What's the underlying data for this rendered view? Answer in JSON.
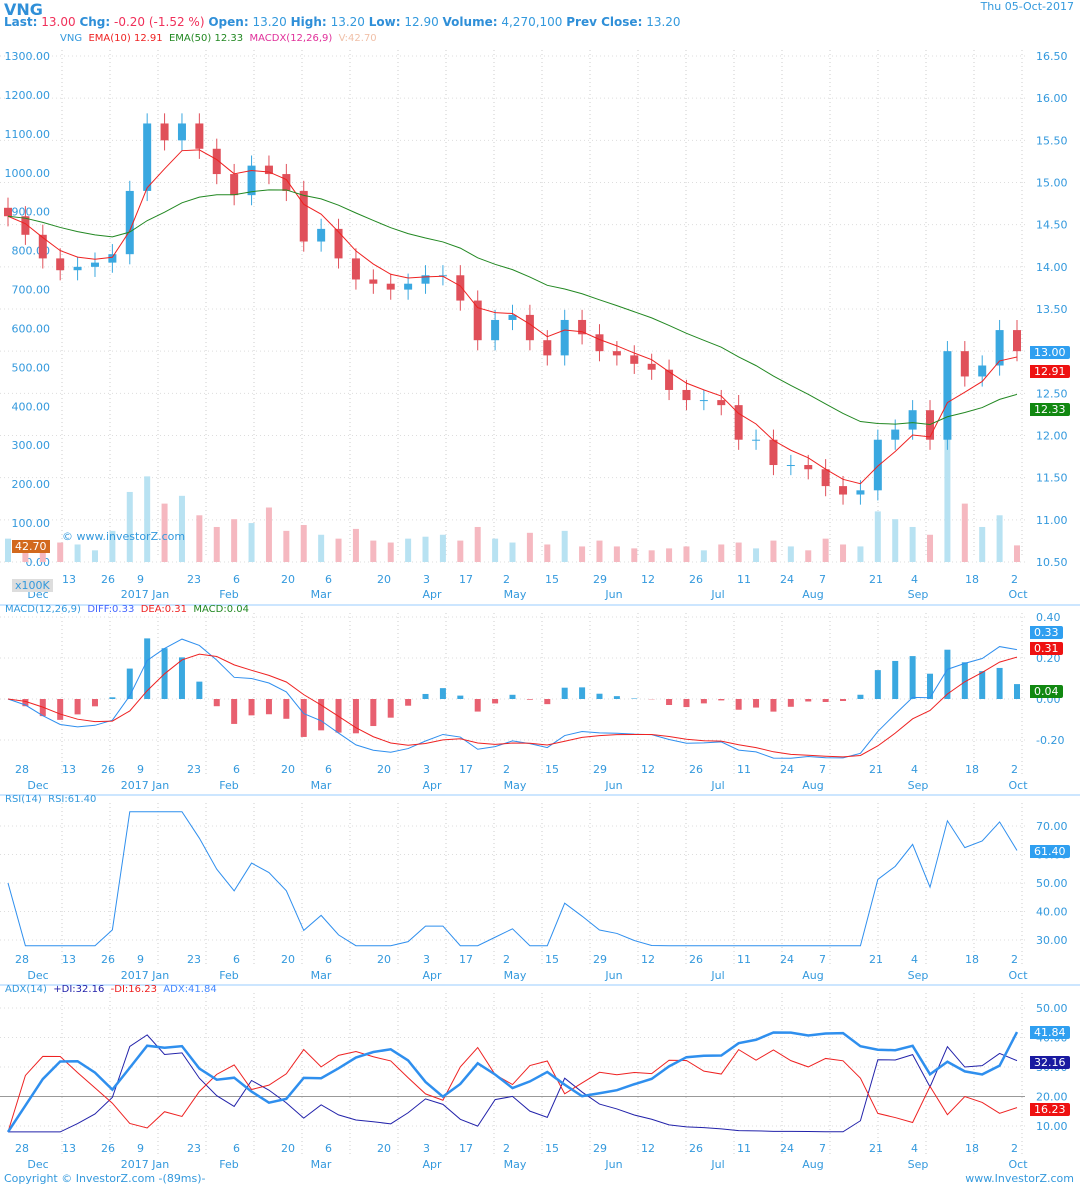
{
  "header": {
    "symbol": "VNG",
    "date": "Thu 05-Oct-2017",
    "last_label": "Last:",
    "last": "13.00",
    "chg_label": "Chg:",
    "chg": "-0.20 (-1.52 %)",
    "open_label": "Open:",
    "open": "13.20",
    "high_label": "High:",
    "high": "13.20",
    "low_label": "Low:",
    "low": "12.90",
    "volume_label": "Volume:",
    "volume": "4,270,100",
    "prev_label": "Prev Close:",
    "prev": "13.20"
  },
  "legend": {
    "sym": "VNG",
    "ema10": "EMA(10)",
    "ema10_val": "12.91",
    "ema50": "EMA(50)",
    "ema50_val": "12.33",
    "macdx": "MACDX(12,26,9)",
    "vol": "V:42.70"
  },
  "watermark": "© www.investorZ.com",
  "volume_badge": "42.70",
  "volume_unit": "x100K",
  "macd_legend": {
    "name": "MACD(12,26,9)",
    "diff": "DIFF:0.33",
    "dea": "DEA:0.31",
    "macd": "MACD:0.04"
  },
  "rsi_legend": {
    "name": "RSI(14)",
    "val": "RSI:61.40"
  },
  "adx_legend": {
    "name": "ADX(14)",
    "pdi": "+DI:32.16",
    "mdi": "-DI:16.23",
    "adx": "ADX:41.84"
  },
  "badges": {
    "close": "13.00",
    "ema10": "12.91",
    "ema50": "12.33",
    "diff": "0.33",
    "dea": "0.31",
    "macd": "0.04",
    "rsi": "61.40",
    "adx": "41.84",
    "pdi": "32.16",
    "mdi": "16.23"
  },
  "footer": {
    "left": "Copyright © InvestorZ.com -(89ms)-",
    "right": "www.InvestorZ.com"
  },
  "colors": {
    "up": "#3aa8e0",
    "down": "#e0505a",
    "ema10": "#ee2222",
    "ema50": "#228822",
    "macd_hist": "#3aa8e0",
    "adx": "#2f8fee",
    "pdi": "#2222aa",
    "mdi": "#ee2222"
  },
  "chart_data": {
    "type": "candlestick",
    "price_axis": {
      "min": 10.5,
      "max": 16.5,
      "ticks": [
        "16.50",
        "16.00",
        "15.50",
        "15.00",
        "14.50",
        "14.00",
        "13.50",
        "13.00",
        "12.50",
        "12.00",
        "11.50",
        "11.00",
        "10.50"
      ]
    },
    "volume_axis": {
      "min": 0,
      "max": 1300,
      "ticks": [
        "1300.00",
        "1200.00",
        "1100.00",
        "1000.00",
        "900.00",
        "800.00",
        "700.00",
        "600.00",
        "500.00",
        "400.00",
        "300.00",
        "200.00",
        "100.00",
        "0.00"
      ]
    },
    "macd_axis": {
      "ticks": [
        "0.40",
        "0.20",
        "0.00",
        "-0.20"
      ]
    },
    "rsi_axis": {
      "ticks": [
        "70.00",
        "60.00",
        "50.00",
        "40.00",
        "30.00"
      ]
    },
    "adx_axis": {
      "ticks": [
        "50.00",
        "40.00",
        "30.00",
        "20.00",
        "10.00"
      ]
    },
    "x_days": [
      "13",
      "26",
      "9",
      "23",
      "6",
      "20",
      "6",
      "20",
      "3",
      "17",
      "2",
      "15",
      "29",
      "12",
      "26",
      "11",
      "24",
      "7",
      "21",
      "4",
      "18",
      "2"
    ],
    "x_days_lower": [
      "28",
      "13",
      "26",
      "9",
      "23",
      "6",
      "20",
      "6",
      "20",
      "3",
      "17",
      "2",
      "15",
      "29",
      "12",
      "26",
      "11",
      "24",
      "7",
      "21",
      "4",
      "18",
      "2"
    ],
    "x_months": [
      "Dec",
      "2017 Jan",
      "Feb",
      "Mar",
      "Apr",
      "May",
      "Jun",
      "Jul",
      "Aug",
      "Sep",
      "Oct"
    ],
    "close": [
      14.6,
      14.38,
      14.1,
      13.96,
      14.0,
      14.05,
      14.15,
      14.9,
      15.7,
      15.5,
      15.7,
      15.4,
      15.1,
      14.85,
      15.2,
      15.1,
      14.9,
      14.3,
      14.45,
      14.1,
      13.85,
      13.8,
      13.73,
      13.8,
      13.9,
      13.9,
      13.6,
      13.13,
      13.37,
      13.43,
      13.13,
      12.95,
      13.37,
      13.2,
      13.0,
      12.95,
      12.85,
      12.78,
      12.54,
      12.42,
      12.42,
      12.36,
      11.95,
      11.95,
      11.65,
      11.65,
      11.6,
      11.4,
      11.3,
      11.35,
      11.95,
      12.07,
      12.3,
      11.95,
      13.0,
      12.7,
      12.83,
      13.25,
      13.0
    ],
    "volume": [
      60,
      40,
      35,
      50,
      45,
      30,
      80,
      180,
      220,
      150,
      170,
      120,
      90,
      110,
      100,
      140,
      80,
      95,
      70,
      60,
      85,
      55,
      50,
      60,
      65,
      70,
      55,
      90,
      60,
      50,
      75,
      45,
      80,
      40,
      55,
      40,
      35,
      30,
      35,
      40,
      30,
      45,
      50,
      35,
      55,
      40,
      30,
      60,
      45,
      40,
      130,
      110,
      90,
      70,
      330,
      150,
      90,
      120,
      42.7
    ]
  }
}
